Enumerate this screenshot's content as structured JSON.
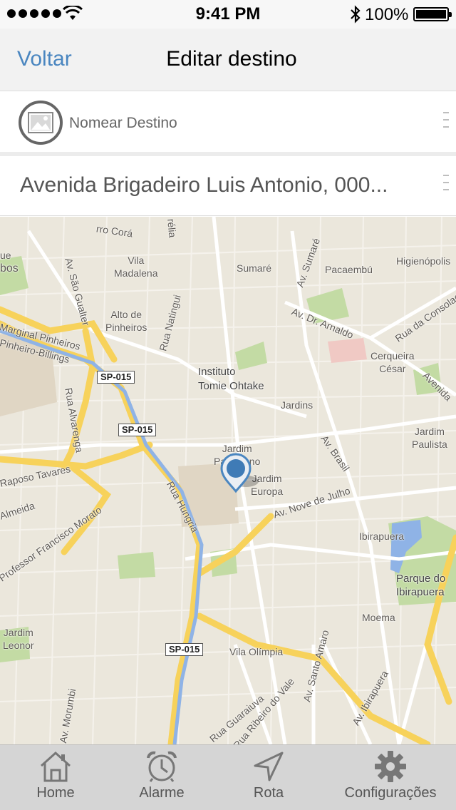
{
  "status_bar": {
    "time": "9:41 PM",
    "battery": "100%",
    "icons": [
      "signal-icon",
      "wifi-icon",
      "bluetooth-icon",
      "battery-icon"
    ]
  },
  "nav": {
    "back_label": "Voltar",
    "title": "Editar destino"
  },
  "destination": {
    "name_placeholder": "Nomear Destino",
    "address": "Avenida Brigadeiro Luis Antonio, 000..."
  },
  "map": {
    "labels": {
      "vila_madalena": "Vila\nMadalena",
      "alto_pinheiros": "Alto de\nPinheiros",
      "sumare": "Sumaré",
      "pacaembu": "Pacaembú",
      "higienopolis": "Higienópolis",
      "av_sao_gualter": "Av. São Gualter",
      "rua_natingui": "Rua Natingui",
      "av_sumare": "Av. Sumaré",
      "av_dr_arnaldo": "Av. Dr. Arnaldo",
      "rua_da_consolacao": "Rua da Consolação",
      "cerqueira_cesar": "Cerqueira\nCésar",
      "instituto": "Instituto\nTomie Ohtake",
      "jardins": "Jardins",
      "av_brasil": "Av. Brasil",
      "jardim_paulista": "Jardim\nPaulista",
      "jardim_paulistano": "Jardim\nPaulistano",
      "jardim_europa": "Jardim\nEuropa",
      "av_nove_de_julho": "Av. Nove de Julho",
      "ibirapuera": "Ibirapuera",
      "parque_ibirapuera": "Parque do\nIbirapuera",
      "moema": "Moema",
      "rua_hungria": "Rua Hungria",
      "rua_alvarenga": "Rua Alvarenga",
      "marginal_pinheiros": "Marginal Pinheiros",
      "pinheiro_billings": "Pinheiro-Billings",
      "raposo_tavares": "Raposo Tavares",
      "almeida": "Almeida",
      "prof_francisco_morato": "Professor Francisco Morato",
      "vila_olimpia": "Vila Olímpia",
      "jardim_leonor": "Jardim\nLeonor",
      "av_morumbi": "Av. Morumbi",
      "rua_guaraiuva": "Rua Guaraiuva",
      "rua_ribeiro_do_vale": "Rua Ribeiro do Vale",
      "av_santo_amaro": "Av. Santo Amaro",
      "av_ibirapuera": "Av. Ibirapuera",
      "avenida": "Avenida",
      "rua_c_hora": "rro Corá",
      "que": "ue",
      "bos": "bos",
      "rel": "rélia"
    },
    "shields": [
      "SP-015",
      "SP-015",
      "SP-015"
    ],
    "pin_icon": "map-pin-icon"
  },
  "tabs": [
    {
      "label": "Home",
      "icon": "home-icon"
    },
    {
      "label": "Alarme",
      "icon": "alarm-clock-icon"
    },
    {
      "label": "Rota",
      "icon": "navigation-arrow-icon"
    },
    {
      "label": "Configurações",
      "icon": "gear-icon"
    }
  ],
  "colors": {
    "accent": "#4a86c0",
    "map_bg": "#ebe7dc",
    "highway": "#f7d25b",
    "river": "#8fb3e6",
    "park": "#c3dba4",
    "tab_bar": "#d5d5d5"
  }
}
